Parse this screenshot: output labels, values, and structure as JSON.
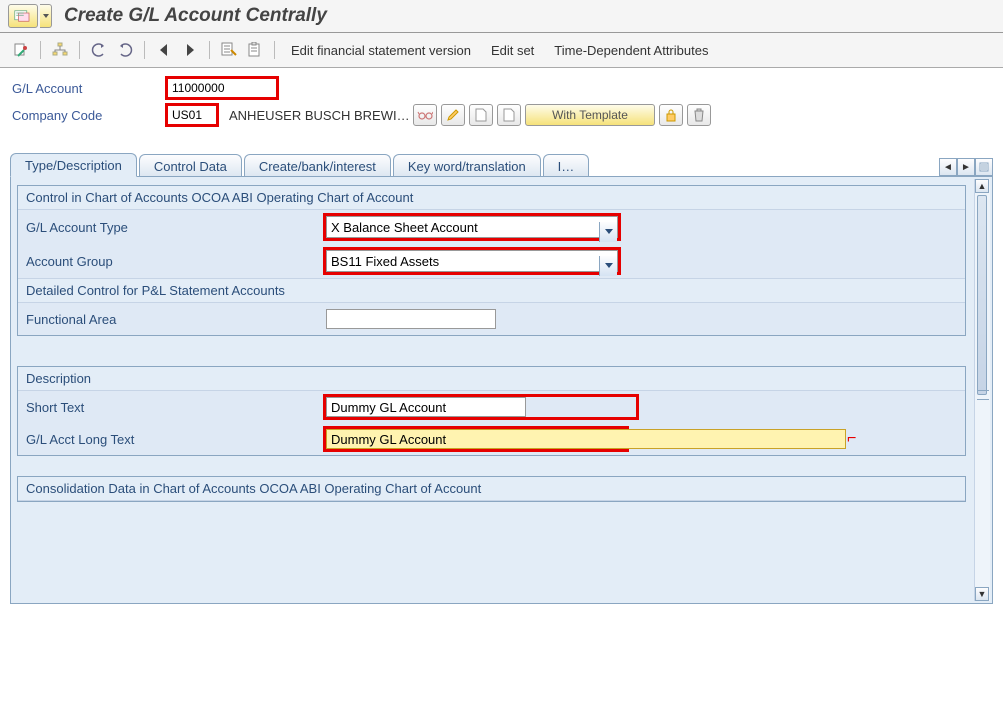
{
  "title": "Create G/L Account Centrally",
  "toolbar_links": {
    "edit_fsv": "Edit financial statement version",
    "edit_set": "Edit set",
    "time_dep": "Time-Dependent Attributes"
  },
  "header": {
    "gl_account_label": "G/L Account",
    "gl_account_value": "11000000",
    "company_code_label": "Company Code",
    "company_code_value": "US01",
    "company_desc": "ANHEUSER BUSCH BREWI…",
    "with_template": "With Template"
  },
  "tabs": {
    "t1": "Type/Description",
    "t2": "Control Data",
    "t3": "Create/bank/interest",
    "t4": "Key word/translation",
    "t5": "I…"
  },
  "group1": {
    "title": "Control in Chart of Accounts OCOA ABI Operating Chart of Account",
    "gl_type_label": "G/L Account Type",
    "gl_type_value": "X Balance Sheet Account",
    "acct_group_label": "Account Group",
    "acct_group_value": "BS11 Fixed Assets",
    "detailed_title": "Detailed Control for P&L Statement Accounts",
    "func_area_label": "Functional Area",
    "func_area_value": ""
  },
  "group2": {
    "title": "Description",
    "short_label": "Short Text",
    "short_value": "Dummy GL Account",
    "long_label": "G/L Acct Long Text",
    "long_value": "Dummy GL Account"
  },
  "group3": {
    "title": "Consolidation Data in Chart of Accounts OCOA ABI Operating Chart of Account"
  }
}
